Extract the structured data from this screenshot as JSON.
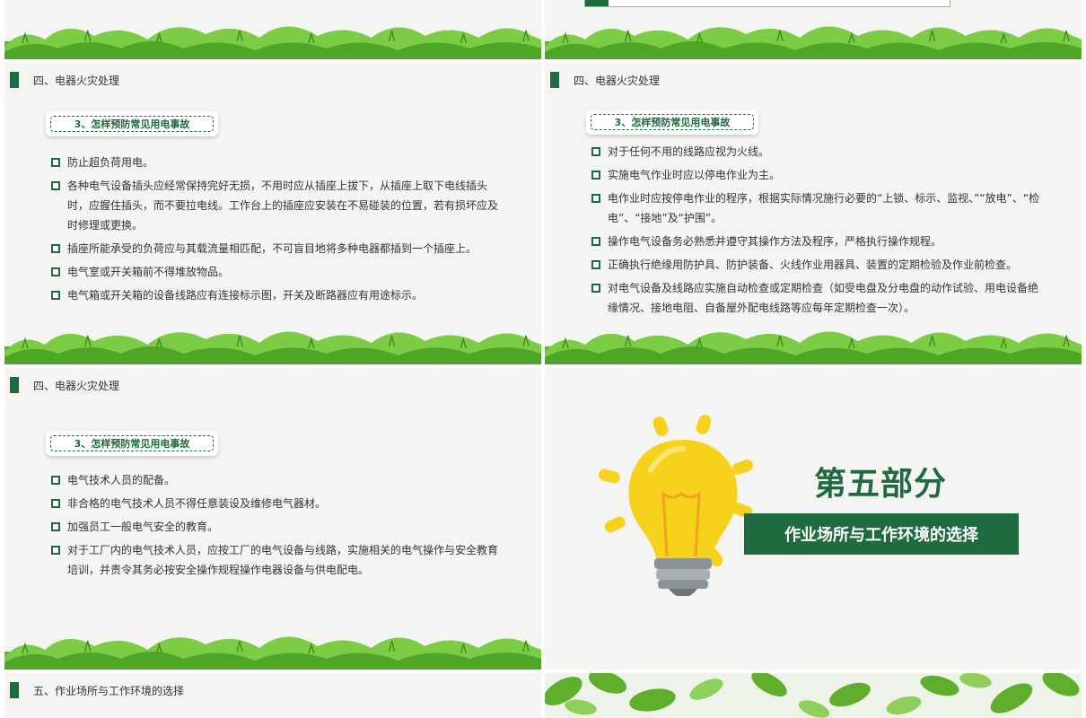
{
  "slide1": {
    "grass_top": true
  },
  "slide2": {
    "grass_top": true
  },
  "slide3": {
    "section_title": "四、电器火灾处理",
    "subtitle": "3、怎样预防常见用电事故",
    "items": [
      "防止超负荷用电。",
      "各种电气设备插头应经常保持完好无损，不用时应从插座上拔下，从插座上取下电线插头时，应握住插头，而不要拉电线。工作台上的插座应安装在不易碰装的位置，若有损坏应及时修理或更换。",
      "插座所能承受的负荷应与其载流量相匹配，不可盲目地将多种电器都插到一个插座上。",
      "电气室或开关箱前不得堆放物品。",
      "电气箱或开关箱的设备线路应有连接标示图，开关及断路器应有用途标示。"
    ]
  },
  "slide4": {
    "section_title": "四、电器火灾处理",
    "subtitle": "3、怎样预防常见用电事故",
    "items": [
      "对于任何不用的线路应视为火线。",
      "实施电气作业时应以停电作业为主。",
      "电作业时应按停电作业的程序，根据实际情况施行必要的“上锁、标示、监视、”“放电”、“检电”、“接地”及“护围”。",
      "操作电气设备务必熟悉并遵守其操作方法及程序，严格执行操作规程。",
      "正确执行绝缘用防护具、防护装备、火线作业用器具、装置的定期检验及作业前检查。",
      "对电气设备及线路应实施自动检查或定期检查（如受电盘及分电盘的动作试验、用电设备绝缘情况、接地电阻、自备屋外配电线路等应每年定期检查一次）。"
    ]
  },
  "slide5": {
    "section_title": "四、电器火灾处理",
    "subtitle": "3、怎样预防常见用电事故",
    "items": [
      "电气技术人员的配备。",
      "非合格的电气技术人员不得任意装设及维修电气器材。",
      "加强员工一般电气安全的教育。",
      "对于工厂内的电气技术人员，应按工厂的电气设备与线路，实施相关的电气操作与安全教育培训，并责令其务必按安全操作规程操作电器设备与供电配电。"
    ]
  },
  "slide6": {
    "part_title": "第五部分",
    "part_subtitle": "作业场所与工作环境的选择"
  },
  "slide7": {
    "section_title": "五、作业场所与工作环境的选择"
  },
  "colors": {
    "accent": "#1f6b3f",
    "grass": "#6cc23a",
    "bulb": "#f6d21c"
  }
}
